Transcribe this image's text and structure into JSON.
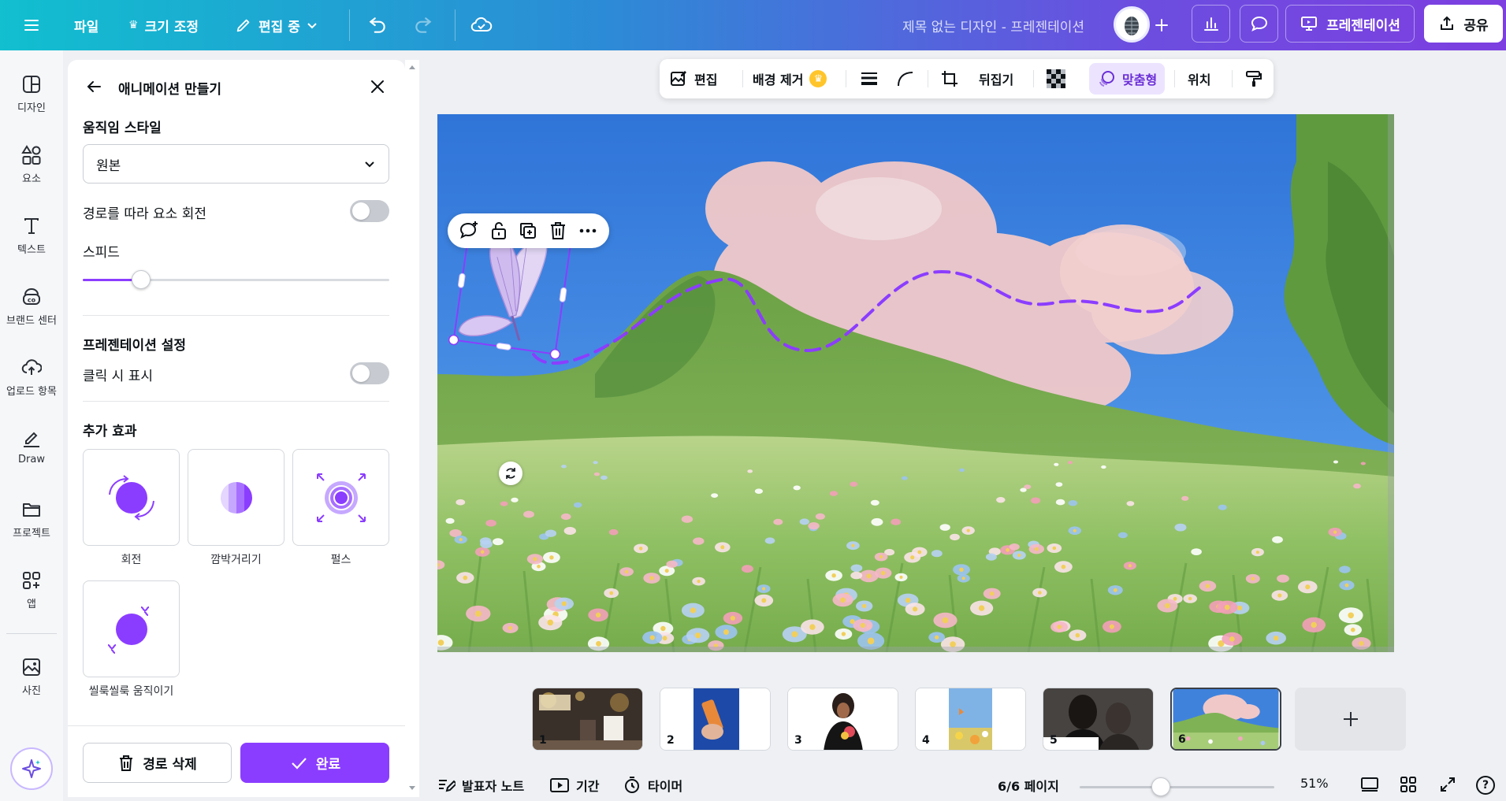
{
  "topbar": {
    "file": "파일",
    "resize": "크기 조정",
    "editing": "편집 중",
    "doc_title": "제목 없는 디자인 - 프레젠테이션",
    "present": "프레젠테이션",
    "share": "공유"
  },
  "rail": {
    "items": [
      {
        "label": "디자인",
        "icon": "design-icon"
      },
      {
        "label": "요소",
        "icon": "elements-icon"
      },
      {
        "label": "텍스트",
        "icon": "text-icon"
      },
      {
        "label": "브랜드 센터",
        "icon": "brand-icon"
      },
      {
        "label": "업로드 항목",
        "icon": "upload-icon"
      },
      {
        "label": "Draw",
        "icon": "draw-icon"
      },
      {
        "label": "프로젝트",
        "icon": "folder-icon"
      },
      {
        "label": "앱",
        "icon": "apps-icon"
      },
      {
        "label": "사진",
        "icon": "photo-icon"
      }
    ]
  },
  "panel": {
    "title": "애니메이션 만들기",
    "motion_style_heading": "움직임 스타일",
    "motion_style_value": "원본",
    "rotate_along_path_label": "경로를 따라 요소 회전",
    "rotate_along_path_on": false,
    "speed_heading": "스피드",
    "speed_value": 0.19,
    "presentation_heading": "프레젠테이션 설정",
    "show_on_click_label": "클릭 시 표시",
    "show_on_click_on": false,
    "extra_effects_heading": "추가 효과",
    "effects": [
      "회전",
      "깜박거리기",
      "펄스",
      "씰룩씰룩 움직이기"
    ],
    "delete_path": "경로 삭제",
    "done": "완료"
  },
  "context_toolbar": {
    "edit": "편집",
    "remove_bg": "배경 제거",
    "flip": "뒤집기",
    "fit": "맞춤형",
    "position": "위치"
  },
  "pages": {
    "thumbnails": [
      "1",
      "2",
      "3",
      "4",
      "5",
      "6"
    ],
    "active": "6"
  },
  "bottombar": {
    "notes": "발표자 노트",
    "duration": "기간",
    "timer": "타이머",
    "page_indicator": "6/6 페이지",
    "zoom": "51%",
    "help": "?"
  },
  "colors": {
    "accent": "#8b3dff",
    "topbar_start": "#11bfcf",
    "topbar_end": "#7d3fe0"
  }
}
